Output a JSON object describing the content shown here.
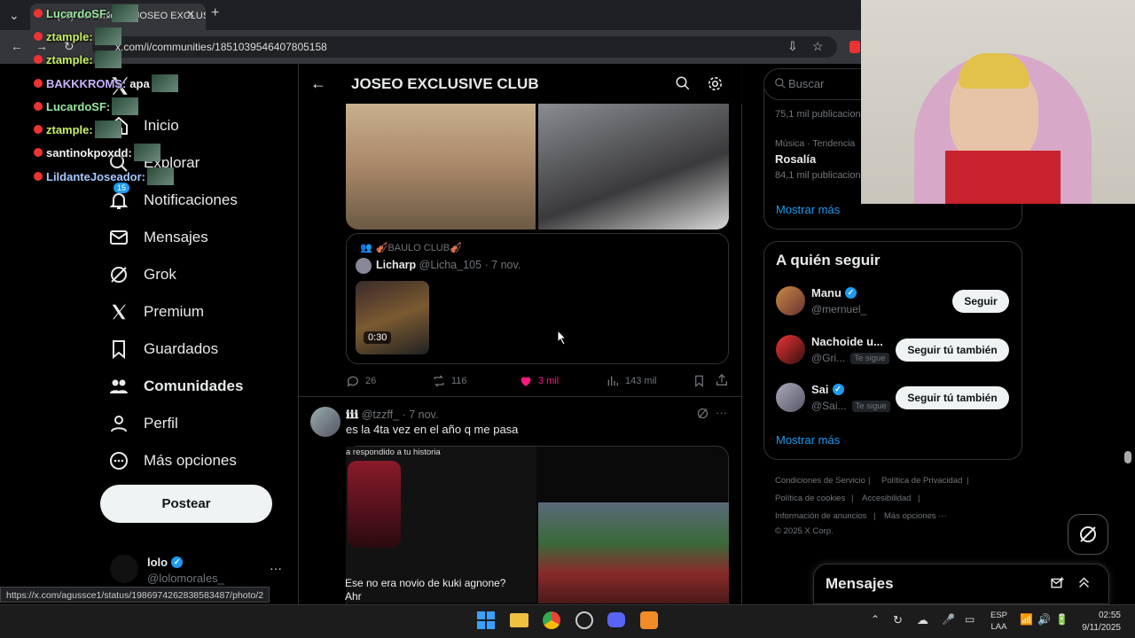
{
  "browser": {
    "tab_title": "(15) Comunidad | JOSEO EXCLUS",
    "url": "x.com/i/communities/1851039546407805158",
    "status_url": "https://x.com/agussce1/status/1986974262838583487/photo/2"
  },
  "chat": [
    {
      "user": "LucardoSF:",
      "text": "",
      "color": "#9be8a0"
    },
    {
      "user": "ztample:",
      "text": "",
      "color": "#c8f066"
    },
    {
      "user": "ztample:",
      "text": "",
      "color": "#c8f066"
    },
    {
      "user": "BAKKKROMS:",
      "text": "apa",
      "color": "#c9b3ff"
    },
    {
      "user": "LucardoSF:",
      "text": "",
      "color": "#9be8a0"
    },
    {
      "user": "ztample:",
      "text": "",
      "color": "#c8f066"
    },
    {
      "user": "santinokpoxdd:",
      "text": "",
      "color": "#f2f2f2"
    },
    {
      "user": "LildanteJoseador:",
      "text": "",
      "color": "#a7c7ff"
    }
  ],
  "nav": {
    "items": [
      {
        "label": "Inicio",
        "icon": "home-icon"
      },
      {
        "label": "Explorar",
        "icon": "search-icon"
      },
      {
        "label": "Notificaciones",
        "icon": "bell-icon",
        "badge": "15"
      },
      {
        "label": "Mensajes",
        "icon": "mail-icon"
      },
      {
        "label": "Grok",
        "icon": "grok-icon"
      },
      {
        "label": "Premium",
        "icon": "x-logo-icon"
      },
      {
        "label": "Guardados",
        "icon": "bookmark-icon"
      },
      {
        "label": "Comunidades",
        "icon": "communities-icon"
      },
      {
        "label": "Perfil",
        "icon": "person-icon"
      },
      {
        "label": "Más opciones",
        "icon": "more-circle-icon"
      }
    ],
    "post_label": "Postear",
    "account_name": "lolo",
    "account_handle": "@lolomorales_"
  },
  "header": {
    "title": "JOSEO EXCLUSIVE CLUB"
  },
  "post1": {
    "quote_community": "🎻BAULO CLUB🎻",
    "quote_name": "Licharp",
    "quote_handle": "@Licha_105",
    "quote_date": "· 7 nov.",
    "video_duration": "0:30",
    "replies": "26",
    "reposts": "116",
    "likes": "3 mil",
    "views": "143 mil",
    "like_color": "#f91880"
  },
  "post2": {
    "name": "ℹℹℹ",
    "handle": "@tzzff_",
    "date": "· 7 nov.",
    "text": "es la 4ta vez en el año q me pasa",
    "image_caption": "a respondido a tu historia",
    "image_text_1": "Ese no era novio de kuki agnone?",
    "image_text_2": "Ahr"
  },
  "right": {
    "search_placeholder": "Buscar",
    "trend1_count": "75,1 mil publicaciones",
    "trend2_category": "Música · Tendencia",
    "trend2_name": "Rosalía",
    "trend2_count": "84,1 mil publicaciones",
    "show_more": "Mostrar más",
    "follow_title": "A quién seguir",
    "follow": [
      {
        "name": "Manu",
        "handle": "@mernuel_",
        "button": "Seguir",
        "follows_you": ""
      },
      {
        "name": "Nachoide u...",
        "handle": "@Gri...",
        "button": "Seguir tú también",
        "follows_you": "Te sigue"
      },
      {
        "name": "Sai",
        "handle": "@Sai...",
        "button": "Seguir tú también",
        "follows_you": "Te sigue"
      }
    ],
    "follow_more": "Mostrar más",
    "footer": {
      "terms": "Condiciones de Servicio",
      "privacy": "Política de Privacidad",
      "cookies": "Política de cookies",
      "accessibility": "Accesibilidad",
      "ads": "Información de anuncios",
      "more": "Más opciones ···",
      "copyright": "© 2025 X Corp."
    },
    "messages_label": "Mensajes"
  },
  "taskbar": {
    "lang1": "ESP",
    "lang2": "LAA",
    "time": "02:55",
    "date": "9/11/2025"
  }
}
